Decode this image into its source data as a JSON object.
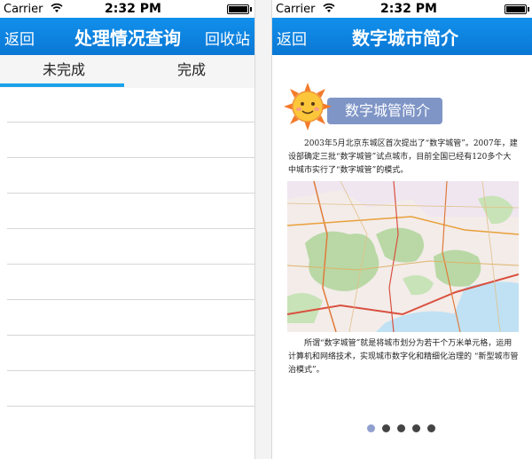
{
  "left_screen": {
    "status_bar": {
      "carrier": "Carrier",
      "time": "2:32 PM"
    },
    "nav_bar": {
      "back_label": "返回",
      "title": "处理情况查询",
      "right_label": "回收站"
    },
    "tabs": [
      {
        "label": "未完成",
        "selected": true
      },
      {
        "label": "完成",
        "selected": false
      }
    ],
    "list_rows": 9
  },
  "right_screen": {
    "status_bar": {
      "carrier": "Carrier",
      "time": "2:32 PM"
    },
    "nav_bar": {
      "back_label": "返回",
      "title": "数字城市简介"
    },
    "banner_label": "数字城管简介",
    "paragraph_1": "2003年5月北京东城区首次提出了“数字城管”。2007年，建设部确定三批“数字城管”试点城市，目前全国已经有120多个大中城市实行了“数字城管”的模式。",
    "paragraph_2": "所谓“数字城管”就是将城市划分为若干个万米单元格，运用计算机和网络技术，实现城市数字化和精细化治理的 “新型城市管治模式”。",
    "page_indicator": {
      "count": 5,
      "current": 1
    }
  },
  "colors": {
    "nav_bar": "#0a82de",
    "tab_indicator": "#1aa2ea",
    "banner_label_bg": "#7f95c6",
    "dot_active": "#8fa0cf",
    "dot_inactive": "#444444"
  },
  "icons": [
    "wifi-icon",
    "battery-icon",
    "sun-icon",
    "map-image"
  ]
}
